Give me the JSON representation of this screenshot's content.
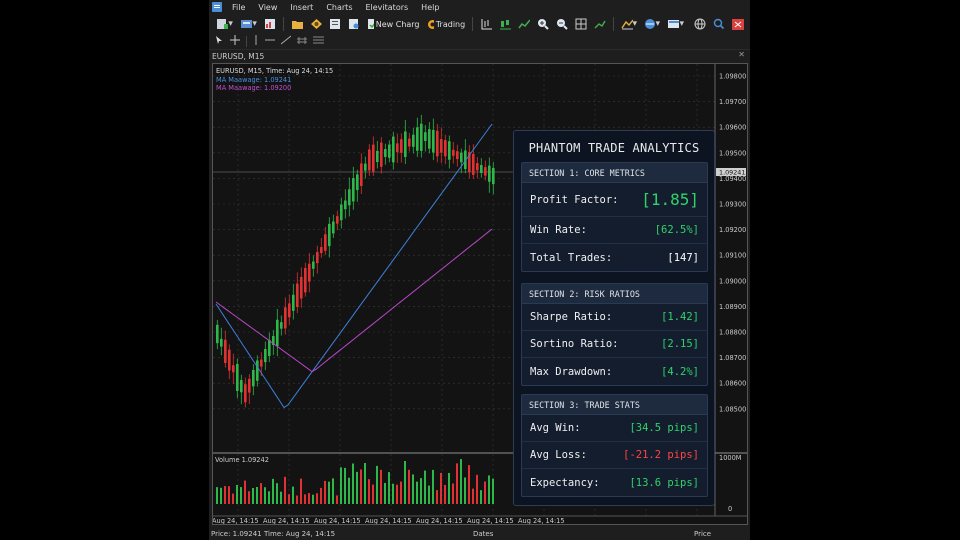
{
  "menu": [
    "File",
    "View",
    "Insert",
    "Charts",
    "Elevitators",
    "Help"
  ],
  "toolbar": {
    "new_chart_label": "New Charg",
    "trading_label": "Trading"
  },
  "chart_window": {
    "title": "EURUSD, M15",
    "info_line": "EURUSD, M15, Time: Aug 24, 14:15",
    "ma1_label": "MA Maawage: 1.09241",
    "ma2_label": "MA Maawage: 1.09200",
    "current_price_tag": "1.09241",
    "price_ticks": [
      "1.09800",
      "1.09700",
      "1.09600",
      "1.09500",
      "1.09400",
      "1.09300",
      "1.09200",
      "1.09100",
      "1.09000",
      "1.08900",
      "1.08800",
      "1.08700",
      "1.08600",
      "1.08500"
    ],
    "volume_label": "Volume 1.09242",
    "volume_ticks": [
      "1000M",
      "0"
    ],
    "time_labels": [
      "Aug 24, 14:15",
      "Aug 24, 14:15",
      "Aug 24, 14:15",
      "Aug 24, 14:15",
      "Aug 24, 14:15",
      "Aug 24, 14:15",
      "Aug 24, 14:15"
    ],
    "colors": {
      "bull": "#2fb84a",
      "bear": "#e03232",
      "ma_fast": "#3f7fd8",
      "ma_slow": "#b848c8",
      "grid": "#3a3a3a"
    }
  },
  "status": {
    "price": "Price: 1.09241",
    "time": "Time: Aug 24, 14:15",
    "dates": "Dates",
    "price_right": "Price"
  },
  "analytics": {
    "title": "PHANTOM TRADE ANALYTICS",
    "sections": [
      {
        "header": "SECTION 1: CORE METRICS",
        "rows": [
          {
            "label": "Profit Factor:",
            "value": "[1.85]"
          },
          {
            "label": "Win Rate:",
            "value": "[62.5%]"
          },
          {
            "label": "Total Trades:",
            "value": "[147]"
          }
        ]
      },
      {
        "header": "SECTION 2: RISK RATIOS",
        "rows": [
          {
            "label": "Sharpe Ratio:",
            "value": "[1.42]"
          },
          {
            "label": "Sortino Ratio:",
            "value": "[2.15]"
          },
          {
            "label": "Max Drawdown:",
            "value": "[4.2%]"
          }
        ]
      },
      {
        "header": "SECTION 3: TRADE STATS",
        "rows": [
          {
            "label": "Avg Win:",
            "value": "[34.5 pips]"
          },
          {
            "label": "Avg Loss:",
            "value": "[-21.2 pips]"
          },
          {
            "label": "Expectancy:",
            "value": "[13.6 pips]"
          }
        ]
      }
    ]
  }
}
